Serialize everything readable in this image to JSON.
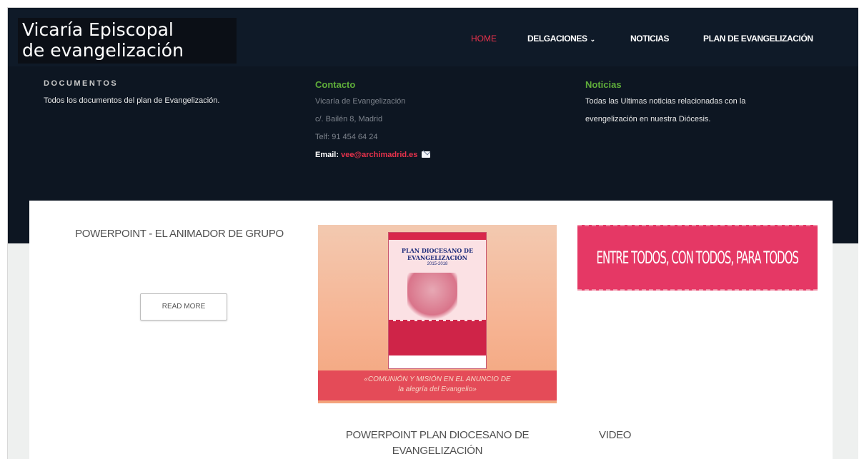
{
  "site": {
    "title_line1": "Vicaría Episcopal",
    "title_line2": "de evangelización"
  },
  "nav": {
    "items": [
      {
        "label": "HOME",
        "active": true
      },
      {
        "label": "DELGACIONES",
        "has_dropdown": true
      },
      {
        "label": "NOTICIAS"
      },
      {
        "label": "PLAN DE EVANGELIZACIÓN"
      }
    ]
  },
  "footer": {
    "documentos": {
      "heading": "DOCUMENTOS",
      "text": "Todos los documentos del plan de Evangelización."
    },
    "contacto": {
      "heading": "Contacto",
      "line1": "Vicaría de Evangelización",
      "line2": "c/. Bailén 8, Madrid",
      "line3": "Telf: 91 454 64 24",
      "email_label": "Email:",
      "email": "vee@archimadrid.es"
    },
    "noticias": {
      "heading": "Noticias",
      "line1": "Todas las Ultimas noticias relacionadas con la",
      "line2": "evengelización en nuestra Diócesis."
    }
  },
  "cards": {
    "card1": {
      "title": "POWERPOINT - EL ANIMADOR DE GRUPO",
      "button": "READ MORE"
    },
    "card2": {
      "title": "POWERPOINT PLAN DIOCESANO DE EVANGELIZACIÓN"
    },
    "card3": {
      "title": "VIDEO"
    }
  },
  "poster": {
    "title": "PLAN DIOCESANO DE EVANGELIZACIÓN",
    "years": "2015-2018",
    "banner_line1": "«COMUNIÓN Y MISIÓN EN EL ANUNCIO DE",
    "banner_line2": "la alegría del Evangelio»"
  },
  "banner2": {
    "text": "ENTRE TODOS, CON TODOS, PARA TODOS"
  },
  "colors": {
    "header_bg": "#0f1a28",
    "active_nav": "#e8324c",
    "green_heading": "#5fae3a",
    "banner_pink": "#e53865"
  }
}
